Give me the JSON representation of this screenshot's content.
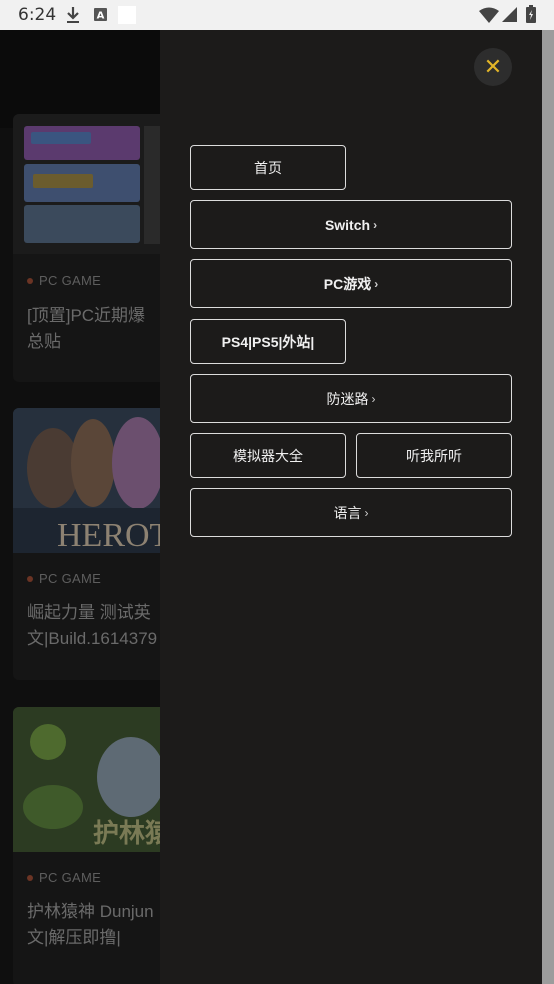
{
  "status_bar": {
    "time": "6:24"
  },
  "background_page": {
    "cards": [
      {
        "tag": "PC GAME",
        "title_lines": [
          "[顶置]PC近期爆",
          "总贴"
        ]
      },
      {
        "tag": "PC GAME",
        "title_lines": [
          "崛起力量 测试英",
          "文|Build.1614379"
        ],
        "thumb_text": "HEROT"
      },
      {
        "tag": "PC GAME",
        "title_lines": [
          "护林猿神 Dunjun",
          "文|解压即撸|"
        ],
        "thumb_text": "护林猿"
      }
    ]
  },
  "drawer": {
    "close_icon": "close-icon",
    "menu": {
      "home": "首页",
      "switch": "Switch",
      "pc_games": "PC游戏",
      "ps_sites": "PS4|PS5|外站|",
      "anti_lost": "防迷路",
      "emulators": "模拟器大全",
      "listen": "听我所听",
      "language": "语言"
    },
    "chevron": "›"
  },
  "colors": {
    "accent": "#e2b528",
    "drawer_bg": "#1c1b1a",
    "button_border": "#dcdcdc"
  }
}
